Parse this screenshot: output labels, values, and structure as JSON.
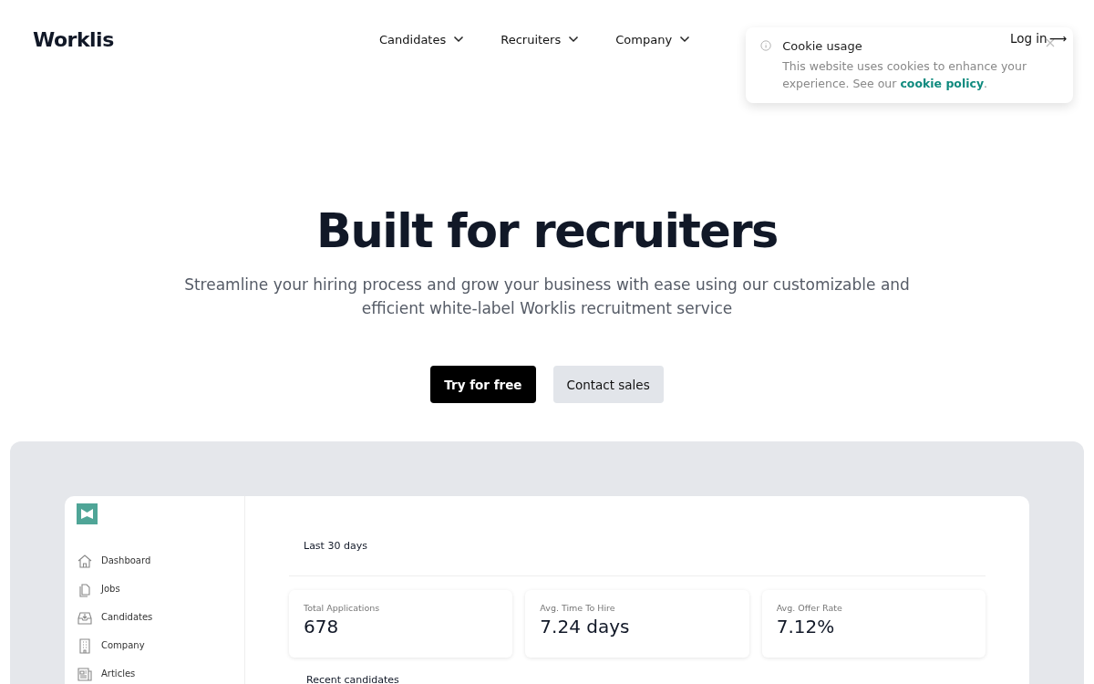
{
  "header": {
    "logo": "Worklis",
    "nav": [
      {
        "label": "Candidates"
      },
      {
        "label": "Recruiters"
      },
      {
        "label": "Company"
      }
    ],
    "login": "Log in",
    "login_arrow": "⟶"
  },
  "cookie_popup": {
    "title": "Cookie usage",
    "text": "This website uses cookies to enhance your experience. See our ",
    "link": "cookie policy",
    "after": "."
  },
  "hero": {
    "title": "Built for recruiters",
    "subtitle": "Streamline your hiring process and grow your business with ease using our customizable and efficient white-label Worklis recruitment service",
    "buttons": [
      {
        "label": "Try for free",
        "kind": "primary"
      },
      {
        "label": "Contact sales",
        "kind": "secondary"
      }
    ]
  },
  "dashboard": {
    "sidebar": {
      "items": [
        {
          "label": "Dashboard"
        },
        {
          "label": "Jobs"
        },
        {
          "label": "Candidates"
        },
        {
          "label": "Company"
        },
        {
          "label": "Articles"
        }
      ]
    },
    "period": "Last 30 days",
    "stats": [
      {
        "label": "Total Applications",
        "value": "678"
      },
      {
        "label": "Avg. Time To Hire",
        "value": "7.24 days"
      },
      {
        "label": "Avg. Offer Rate",
        "value": "7.12%"
      }
    ],
    "section_title": "Recent candidates"
  }
}
